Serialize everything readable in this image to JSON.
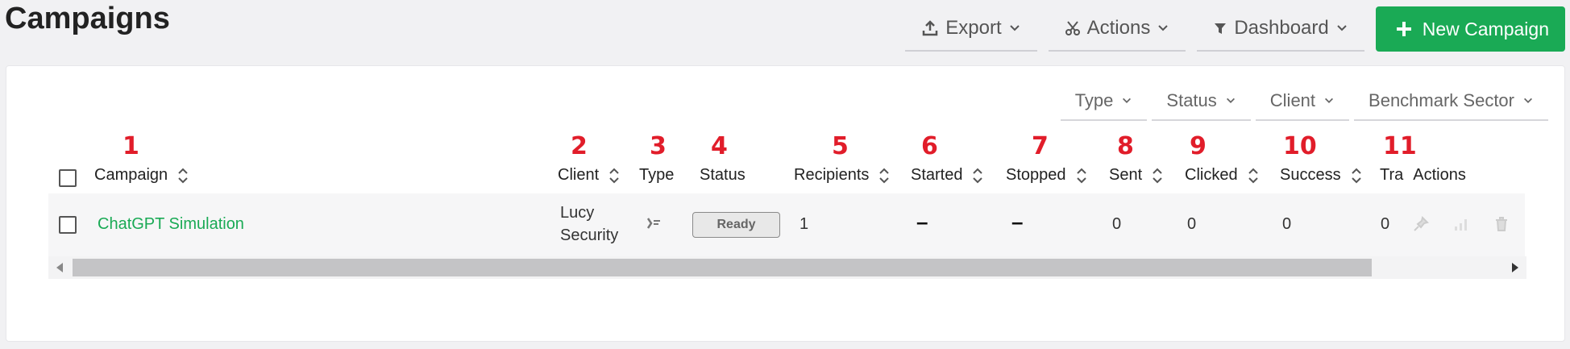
{
  "page": {
    "title": "Campaigns"
  },
  "toolbar": {
    "export_label": "Export",
    "actions_label": "Actions",
    "dashboard_label": "Dashboard",
    "new_campaign_label": "New Campaign"
  },
  "filters": {
    "type": "Type",
    "status": "Status",
    "client": "Client",
    "benchmark": "Benchmark Sector"
  },
  "markers": [
    "1",
    "2",
    "3",
    "4",
    "5",
    "6",
    "7",
    "8",
    "9",
    "10",
    "11"
  ],
  "columns": {
    "campaign": "Campaign",
    "client": "Client",
    "type": "Type",
    "status": "Status",
    "recipients": "Recipients",
    "started": "Started",
    "stopped": "Stopped",
    "sent": "Sent",
    "clicked": "Clicked",
    "success": "Success",
    "tra": "Tra",
    "actions": "Actions"
  },
  "rows": [
    {
      "campaign": "ChatGPT Simulation",
      "client_line1": "Lucy",
      "client_line2": "Security",
      "status": "Ready",
      "recipients": "1",
      "started": "–",
      "stopped": "–",
      "sent": "0",
      "clicked": "0",
      "success": "0",
      "tra": "0"
    }
  ],
  "colors": {
    "accent": "#1aaa55",
    "marker": "#e11d2a"
  }
}
